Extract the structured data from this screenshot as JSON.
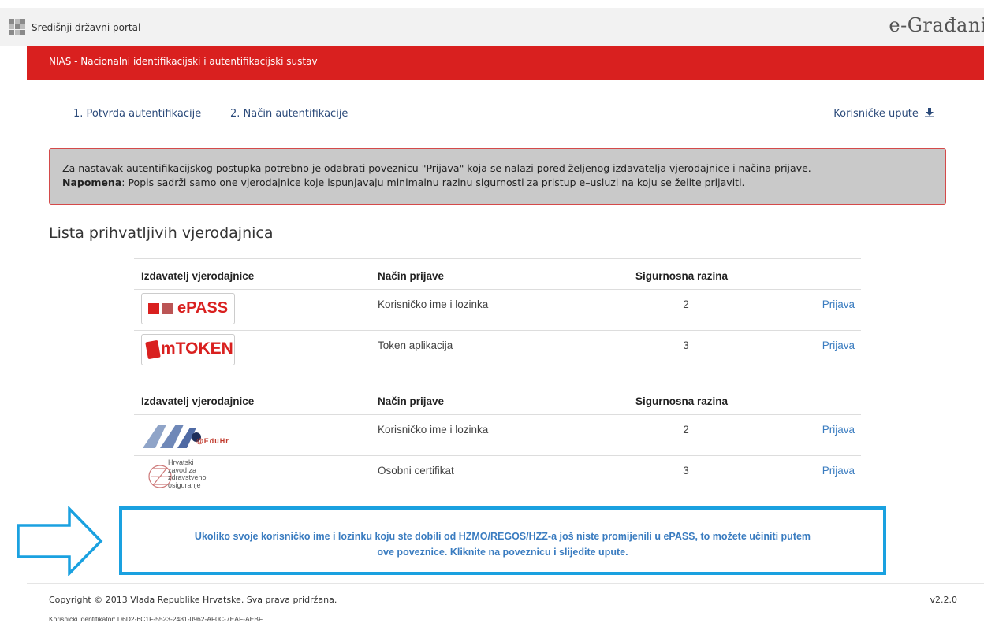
{
  "header": {
    "portal_label": "Središnji državni portal",
    "brand": "e-Građani"
  },
  "banner": {
    "title": "NIAS - Nacionalni identifikacijski i autentifikacijski sustav"
  },
  "steps": {
    "step1": "1. Potvrda autentifikacije",
    "step2": "2. Način autentifikacije",
    "guide_label": "Korisničke upute"
  },
  "notice": {
    "line1": "Za nastavak autentifikacijskog postupka potrebno je odabrati poveznicu \"Prijava\" koja se nalazi pored željenog izdavatelja vjerodajnice i načina prijave.",
    "note_label": "Napomena",
    "line2": ": Popis sadrži samo one vjerodajnice koje ispunjavaju minimalnu razinu sigurnosti za pristup e–usluzi na koju se želite prijaviti."
  },
  "section_title": "Lista prihvatljivih vjerodajnica",
  "columns": {
    "issuer": "Izdavatelj vjerodajnice",
    "method": "Način prijave",
    "level": "Sigurnosna razina"
  },
  "table1": [
    {
      "logo": "ePASS",
      "method": "Korisničko ime i lozinka",
      "level": "2",
      "action": "Prijava"
    },
    {
      "logo": "mTOKEN",
      "method": "Token aplikacija",
      "level": "3",
      "action": "Prijava"
    }
  ],
  "table2": [
    {
      "logo": "@EduHr",
      "method": "Korisničko ime i lozinka",
      "level": "2",
      "action": "Prijava"
    },
    {
      "logo": "Hrvatski zavod za zdravstveno osiguranje",
      "method": "Osobni certifikat",
      "level": "3",
      "action": "Prijava"
    }
  ],
  "logos": {
    "hzzo_line1": "Hrvatski",
    "hzzo_line2": "zavod za",
    "hzzo_line3": "zdravstveno",
    "hzzo_line4": "osiguranje"
  },
  "epass_link": {
    "line1": "Ukoliko svoje korisničko ime i lozinku koju ste dobili od HZMO/REGOS/HZZ-a još niste promijenili u ePASS, to možete učiniti putem",
    "line2": "ove poveznice. Kliknite na poveznicu i slijedite upute."
  },
  "footer": {
    "copyright": "Copyright © 2013 Vlada Republike Hrvatske. Sva prava pridržana.",
    "version": "v2.2.0",
    "user_id": "Korisnički identifikator: D6D2-6C1F-5523-2481-0962-AF0C-7EAF-AEBF"
  },
  "colors": {
    "brand_red": "#d9201f",
    "link_blue": "#3a7cc0",
    "highlight_blue": "#1aa1e0"
  }
}
